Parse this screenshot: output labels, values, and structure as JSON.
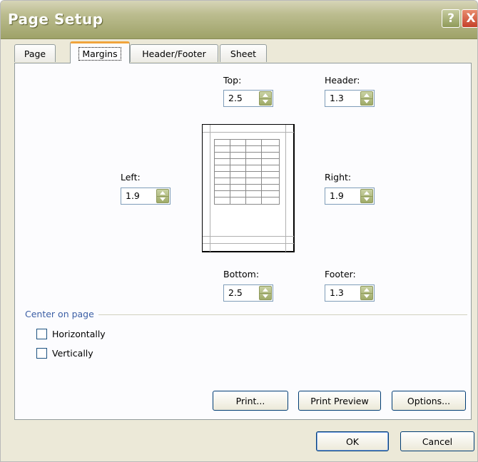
{
  "window": {
    "title": "Page Setup",
    "help_glyph": "?",
    "close_glyph": "X"
  },
  "tabs": [
    {
      "label": "Page"
    },
    {
      "label": "Margins"
    },
    {
      "label": "Header/Footer"
    },
    {
      "label": "Sheet"
    }
  ],
  "margins": {
    "top": {
      "label": "Top:",
      "value": "2.5"
    },
    "header": {
      "label": "Header:",
      "value": "1.3"
    },
    "left": {
      "label": "Left:",
      "value": "1.9"
    },
    "right": {
      "label": "Right:",
      "value": "1.9"
    },
    "bottom": {
      "label": "Bottom:",
      "value": "2.5"
    },
    "footer": {
      "label": "Footer:",
      "value": "1.3"
    }
  },
  "center_on_page": {
    "title": "Center on page",
    "horizontally": {
      "label": "Horizontally",
      "checked": false
    },
    "vertically": {
      "label": "Vertically",
      "checked": false
    }
  },
  "panel_buttons": {
    "print": "Print...",
    "print_preview": "Print Preview",
    "options": "Options..."
  },
  "dialog_buttons": {
    "ok": "OK",
    "cancel": "Cancel"
  }
}
